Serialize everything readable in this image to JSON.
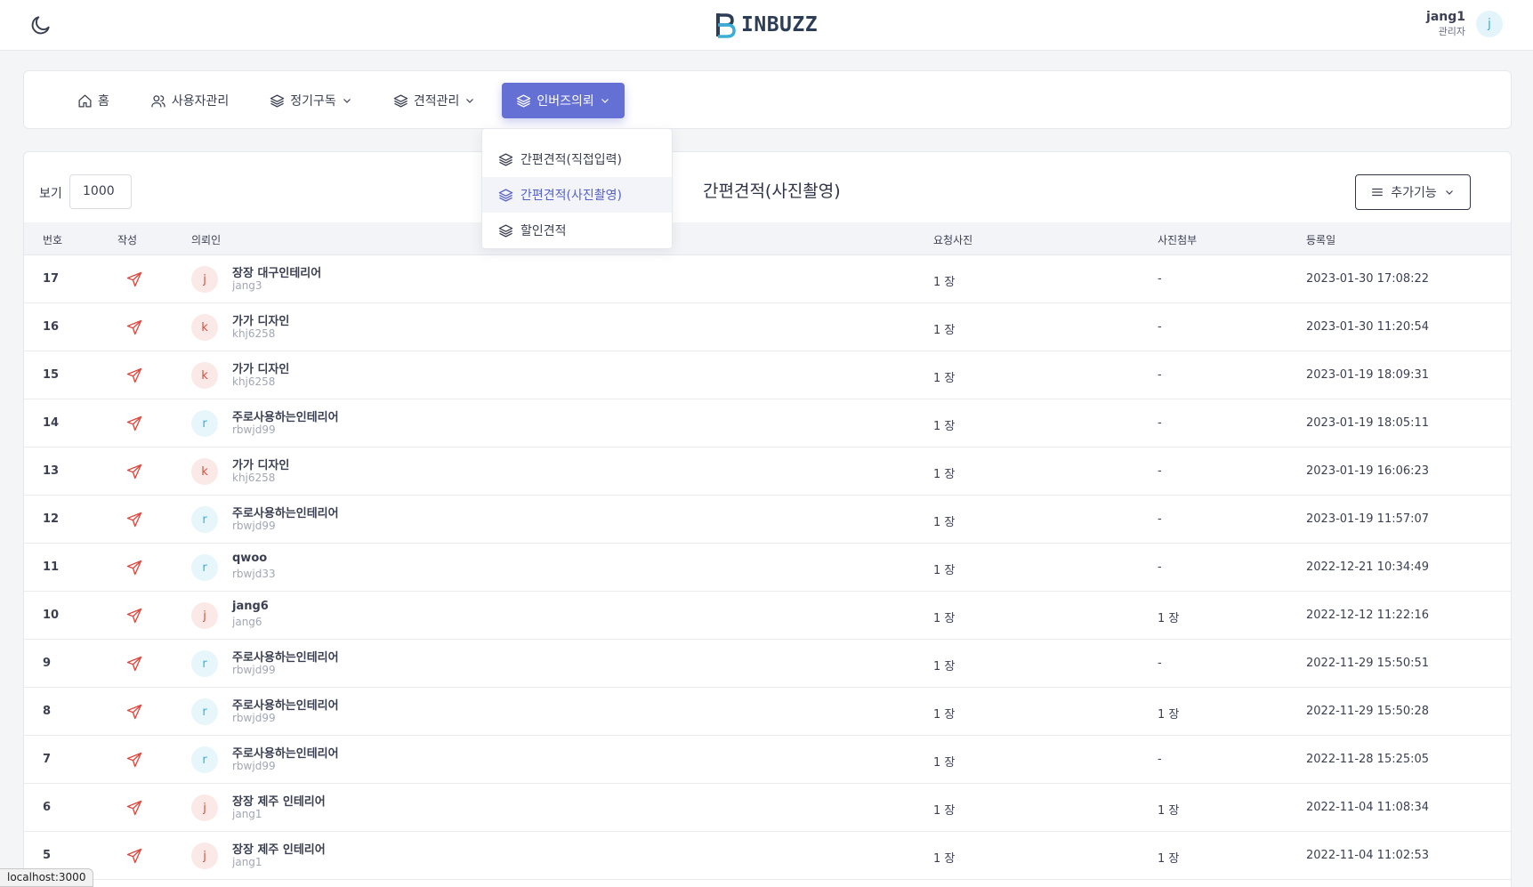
{
  "app": {
    "logo_text": "INBUZZ",
    "brand_color": "#2c3e57",
    "accent_color": "#6470d4"
  },
  "header": {
    "theme_toggle_icon": "moon-icon",
    "user_name": "jang1",
    "user_role": "관리자",
    "user_avatar": "j"
  },
  "nav": {
    "items": [
      {
        "label": "홈",
        "icon": "home-icon"
      },
      {
        "label": "사용자관리",
        "icon": "users-icon"
      },
      {
        "label": "정기구독",
        "icon": "layers-icon"
      },
      {
        "label": "견적관리",
        "icon": "layers-icon"
      },
      {
        "label": "인버즈의뢰",
        "icon": "layers-icon",
        "active": true
      }
    ]
  },
  "dropdown": {
    "items": [
      {
        "label": "간편견적(직접입력)"
      },
      {
        "label": "간편견적(사진촬영)",
        "active": true
      },
      {
        "label": "할인견적"
      }
    ]
  },
  "toolbar": {
    "view_label": "보기",
    "view_value": "1000",
    "page_title": "간편견적(사진촬영)",
    "more_label": "추가기능"
  },
  "table": {
    "columns": {
      "num": "번호",
      "write": "작성",
      "requester": "의뢰인",
      "photos": "요청사진",
      "attach": "사진첨부",
      "date": "등록일"
    },
    "rows": [
      {
        "num": "17",
        "avatar": "j",
        "name": "장장 대구인테리어",
        "id": "jang3",
        "photos": "1 장",
        "attach": "-",
        "date": "2023-01-30 17:08:22"
      },
      {
        "num": "16",
        "avatar": "k",
        "name": "가가 디자인",
        "id": "khj6258",
        "photos": "1 장",
        "attach": "-",
        "date": "2023-01-30 11:20:54"
      },
      {
        "num": "15",
        "avatar": "k",
        "name": "가가 디자인",
        "id": "khj6258",
        "photos": "1 장",
        "attach": "-",
        "date": "2023-01-19 18:09:31"
      },
      {
        "num": "14",
        "avatar": "r",
        "name": "주로사용하는인테리어",
        "id": "rbwjd99",
        "photos": "1 장",
        "attach": "-",
        "date": "2023-01-19 18:05:11"
      },
      {
        "num": "13",
        "avatar": "k",
        "name": "가가 디자인",
        "id": "khj6258",
        "photos": "1 장",
        "attach": "-",
        "date": "2023-01-19 16:06:23"
      },
      {
        "num": "12",
        "avatar": "r",
        "name": "주로사용하는인테리어",
        "id": "rbwjd99",
        "photos": "1 장",
        "attach": "-",
        "date": "2023-01-19 11:57:07"
      },
      {
        "num": "11",
        "avatar": "r",
        "name": "qwoo",
        "id": "rbwjd33",
        "photos": "1 장",
        "attach": "-",
        "date": "2022-12-21 10:34:49"
      },
      {
        "num": "10",
        "avatar": "j",
        "name": "jang6",
        "id": "jang6",
        "photos": "1 장",
        "attach": "1 장",
        "date": "2022-12-12 11:22:16"
      },
      {
        "num": "9",
        "avatar": "r",
        "name": "주로사용하는인테리어",
        "id": "rbwjd99",
        "photos": "1 장",
        "attach": "-",
        "date": "2022-11-29 15:50:51"
      },
      {
        "num": "8",
        "avatar": "r",
        "name": "주로사용하는인테리어",
        "id": "rbwjd99",
        "photos": "1 장",
        "attach": "1 장",
        "date": "2022-11-29 15:50:28"
      },
      {
        "num": "7",
        "avatar": "r",
        "name": "주로사용하는인테리어",
        "id": "rbwjd99",
        "photos": "1 장",
        "attach": "-",
        "date": "2022-11-28 15:25:05"
      },
      {
        "num": "6",
        "avatar": "j",
        "name": "장장 제주 인테리어",
        "id": "jang1",
        "photos": "1 장",
        "attach": "1 장",
        "date": "2022-11-04 11:08:34"
      },
      {
        "num": "5",
        "avatar": "j",
        "name": "장장 제주 인테리어",
        "id": "jang1",
        "photos": "1 장",
        "attach": "1 장",
        "date": "2022-11-04 11:02:53"
      }
    ]
  },
  "browser": {
    "status_url": "localhost:3000"
  }
}
